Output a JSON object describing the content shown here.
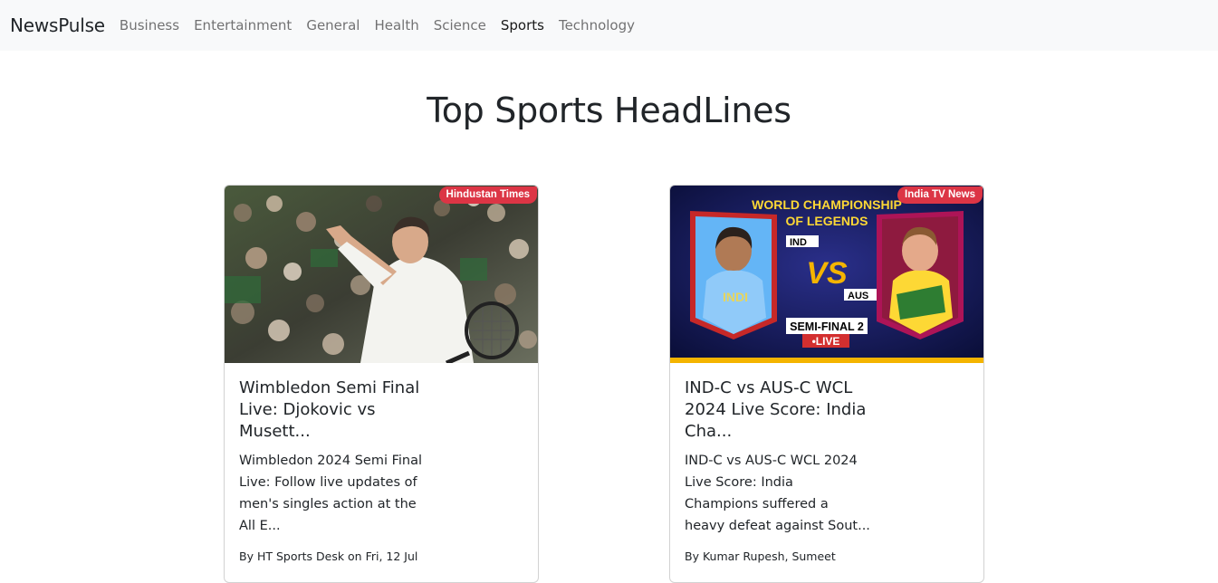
{
  "navbar": {
    "brand": "NewsPulse",
    "links": [
      "Business",
      "Entertainment",
      "General",
      "Health",
      "Science",
      "Sports",
      "Technology"
    ],
    "active": "Sports"
  },
  "page": {
    "heading": "Top Sports HeadLines"
  },
  "cards": [
    {
      "source": "Hindustan Times",
      "title": "Wimbledon Semi Final Live: Djokovic vs Musett...",
      "description": "Wimbledon 2024 Semi Final Live: Follow live updates of men's singles action at the All E...",
      "meta": "By HT Sports Desk on Fri, 12 Jul"
    },
    {
      "source": "India TV News",
      "title": "IND-C vs AUS-C WCL 2024 Live Score: India Cha...",
      "description": "IND-C vs AUS-C WCL 2024 Live Score: India Champions suffered a heavy defeat against Sout...",
      "meta": "By Kumar Rupesh, Sumeet",
      "image_text": {
        "title_line1": "WORLD CHAMPIONSHIP",
        "title_line2": "OF LEGENDS",
        "team1": "IND",
        "team2": "AUS",
        "vs": "VS",
        "stage": "SEMI-FINAL 2",
        "live": "•LIVE"
      }
    }
  ],
  "colors": {
    "badge": "#dc3545",
    "navbar_bg": "#f8f9fa"
  }
}
